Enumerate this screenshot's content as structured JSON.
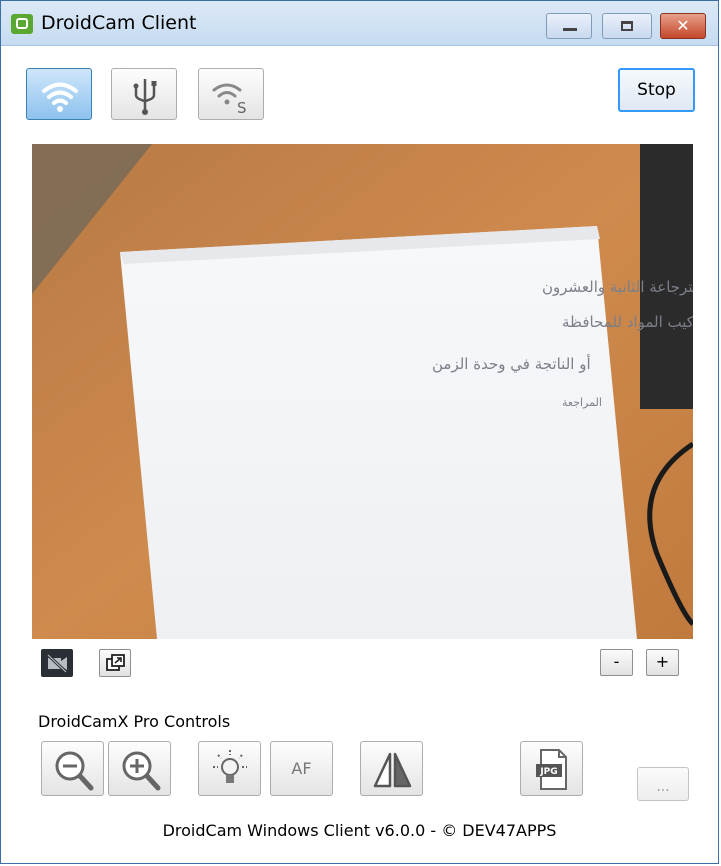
{
  "window": {
    "title": "DroidCam Client",
    "close_glyph": "✕"
  },
  "toolbar": {
    "wifi_icon": "wifi-icon",
    "usb_icon": "usb-icon",
    "wifi_server_icon": "wifi-server-icon",
    "wifi_server_badge": "S",
    "stop_label": "Stop"
  },
  "preview": {
    "handwriting": [
      "استرجاعة الثانية والعشرون",
      "التعريف : هو تبسيط للتغير في تراكيب المواد للمحافظة",
      "أو الناتجة في وحدة الزمن",
      "المراجعة"
    ]
  },
  "preview_controls": {
    "zoom_minus": "-",
    "zoom_plus": "+"
  },
  "pro": {
    "label": "DroidCamX Pro Controls",
    "af_label": "AF",
    "jpg_label": "JPG",
    "more_label": "..."
  },
  "footer": {
    "text": "DroidCam Windows Client v6.0.0 - © DEV47APPS"
  },
  "colors": {
    "active_button": "#8dc2ee",
    "stop_border": "#3399ff",
    "close_button": "#c4472b"
  }
}
